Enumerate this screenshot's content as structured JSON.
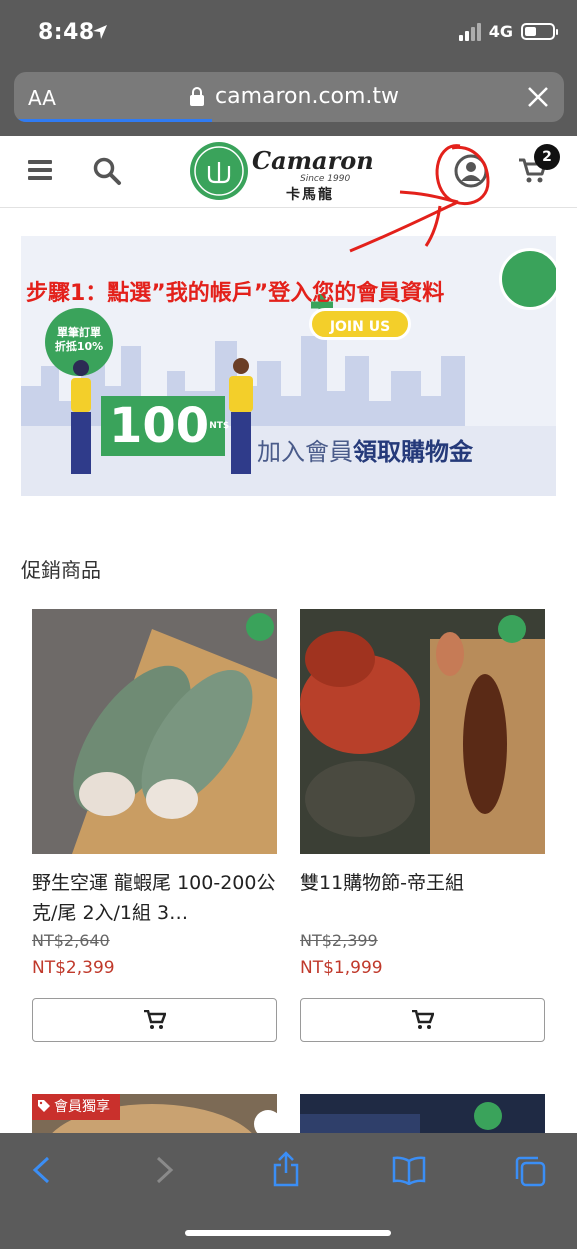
{
  "status_bar": {
    "time": "8:48",
    "network": "4G"
  },
  "browser": {
    "aa_label": "AA",
    "url": "camaron.com.tw"
  },
  "header": {
    "logo_name": "Camaron",
    "logo_since": "Since 1990",
    "logo_chinese": "卡馬龍",
    "cart_count": "2"
  },
  "banner": {
    "badge_line1": "單筆訂單",
    "badge_line2": "折抵10%",
    "join_label": "JOIN US",
    "amount": "100",
    "currency": "NT$",
    "text_prefix": "加入會員",
    "text_bold": "領取購物金"
  },
  "annotation": "步驟1：點選”我的帳戶”登入您的會員資料",
  "section_title": "促銷商品",
  "products": [
    {
      "name": "野生空運 龍蝦尾 100-200公克/尾 2入/1組 3…",
      "old_price": "NT$2,640",
      "new_price": "NT$2,399"
    },
    {
      "name": "雙11購物節-帝王組",
      "old_price": "NT$2,399",
      "new_price": "NT$1,999"
    }
  ],
  "member_tag": "會員獨享",
  "colors": {
    "brand_green": "#3aa35b",
    "sale_red": "#c0392b",
    "annotation_red": "#e3211b"
  }
}
